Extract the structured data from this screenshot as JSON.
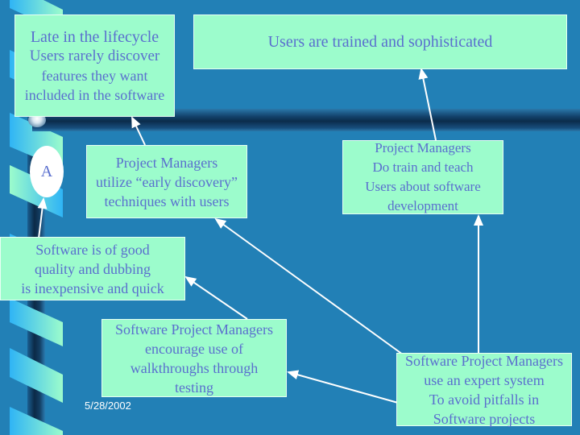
{
  "slide": {
    "background_color": "#2280b6",
    "box_fill": "#9cfccc",
    "text_color": "#5a6fce",
    "date": "5/28/2002"
  },
  "oval": {
    "label": "A"
  },
  "boxes": {
    "late_lifecycle": {
      "lines": [
        "Late in the lifecycle",
        "Users rarely discover",
        "features they want",
        "included in the software"
      ]
    },
    "users_trained": {
      "lines": [
        "Users are trained and sophisticated"
      ]
    },
    "early_discovery": {
      "lines": [
        "Project Managers",
        "utilize “early discovery”",
        "techniques with users"
      ]
    },
    "train_teach": {
      "lines": [
        "Project Managers",
        "Do train and teach",
        "Users about software",
        "development"
      ]
    },
    "good_quality": {
      "lines": [
        "Software is of good",
        "quality and dubbing",
        "is inexpensive and quick"
      ]
    },
    "walkthroughs": {
      "lines": [
        "Software Project Managers",
        "encourage use of",
        "walkthroughs through",
        "testing"
      ]
    },
    "expert_system": {
      "lines": [
        "Software Project Managers",
        "use an expert system",
        "To avoid pitfalls in",
        "Software projects"
      ]
    }
  },
  "connections": [
    {
      "from": "early_discovery",
      "to": "late_lifecycle"
    },
    {
      "from": "train_teach",
      "to": "users_trained"
    },
    {
      "from": "good_quality",
      "to": "oval_A"
    },
    {
      "from": "walkthroughs",
      "to": "good_quality"
    },
    {
      "from": "expert_system",
      "to": "early_discovery"
    },
    {
      "from": "expert_system",
      "to": "walkthroughs"
    },
    {
      "from": "expert_system",
      "to": "train_teach"
    }
  ]
}
